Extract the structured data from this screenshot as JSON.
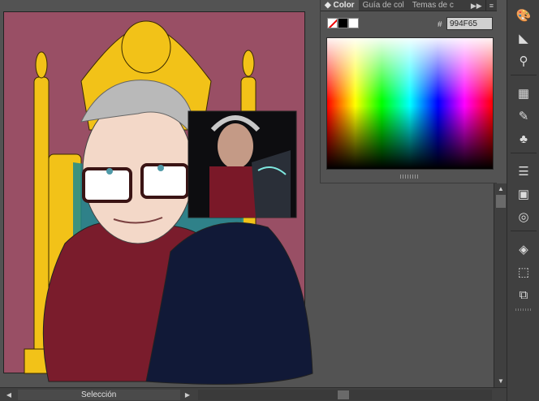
{
  "canvas": {
    "artboard_color": "#994F65",
    "throne_color": "#F2C218",
    "coat_color": "#7A1C2C",
    "jacket_color": "#111937"
  },
  "color_panel": {
    "tabs": [
      {
        "label": "Color",
        "icon": "diamond-icon"
      },
      {
        "label": "Guía de col"
      },
      {
        "label": "Temas de c"
      }
    ],
    "hex_label": "#",
    "hex_value": "994F65",
    "swatches": [
      "none-swatch",
      "black-swatch",
      "white-swatch"
    ]
  },
  "status_bar": {
    "tool_label": "Selección"
  },
  "right_toolbar": {
    "icons": [
      "palette-icon",
      "gradient-icon",
      "symbol-sprayer-icon",
      "swatches-grid-icon",
      "brush-icon",
      "club-icon",
      "stroke-lines-icon",
      "gradient-swatch-icon",
      "transparency-icon",
      "layers-icon",
      "artboard-icon",
      "arrange-icon"
    ]
  }
}
